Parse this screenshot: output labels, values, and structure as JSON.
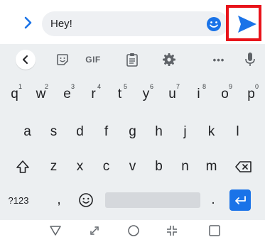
{
  "compose": {
    "message_text": "Hey!",
    "expand_icon": "chevron-right-icon",
    "emoji_icon": "smiley-icon",
    "send_icon": "send-icon",
    "accent_color": "#1a73e8",
    "highlight_color": "#e8141b"
  },
  "keyboard_toolbar": {
    "back_icon": "chevron-left-icon",
    "sticker_icon": "sticker-icon",
    "gif_label": "GIF",
    "clipboard_icon": "clipboard-icon",
    "settings_icon": "gear-icon",
    "more_label": "•••",
    "mic_icon": "microphone-icon"
  },
  "keyboard_rows": {
    "row1": [
      {
        "key": "q",
        "hint": "1"
      },
      {
        "key": "w",
        "hint": "2"
      },
      {
        "key": "e",
        "hint": "3"
      },
      {
        "key": "r",
        "hint": "4"
      },
      {
        "key": "t",
        "hint": "5"
      },
      {
        "key": "y",
        "hint": "6"
      },
      {
        "key": "u",
        "hint": "7"
      },
      {
        "key": "i",
        "hint": "8"
      },
      {
        "key": "o",
        "hint": "9"
      },
      {
        "key": "p",
        "hint": "0"
      }
    ],
    "row2": [
      "a",
      "s",
      "d",
      "f",
      "g",
      "h",
      "j",
      "k",
      "l"
    ],
    "row3": [
      "z",
      "x",
      "c",
      "v",
      "b",
      "n",
      "m"
    ],
    "row4": {
      "symbols_label": "?123",
      "comma": ",",
      "period": "."
    }
  },
  "navigation_bar": {
    "icons": [
      "back-triangle-icon",
      "rotate-icon",
      "home-circle-icon",
      "collapse-icon",
      "recents-square-icon"
    ]
  }
}
